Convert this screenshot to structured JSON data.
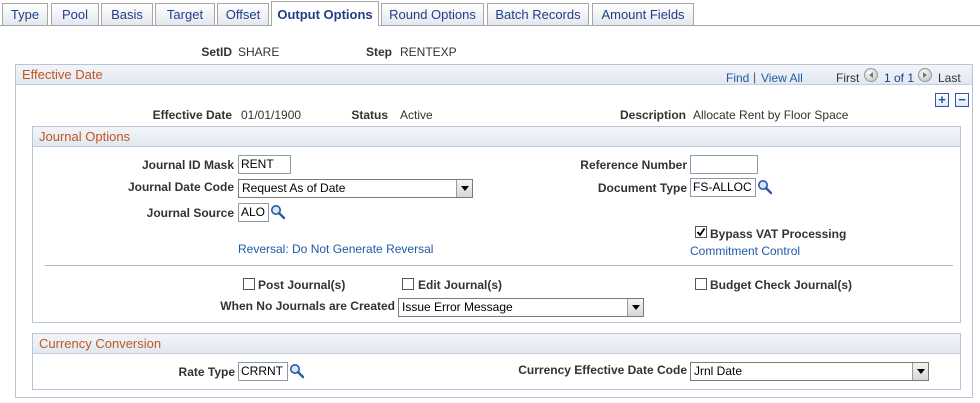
{
  "tabs": [
    {
      "label": "Type",
      "active": false
    },
    {
      "label": "Pool",
      "active": false
    },
    {
      "label": "Basis",
      "active": false
    },
    {
      "label": "Target",
      "active": false
    },
    {
      "label": "Offset",
      "active": false
    },
    {
      "label": "Output Options",
      "active": true
    },
    {
      "label": "Round Options",
      "active": false
    },
    {
      "label": "Batch Records",
      "active": false
    },
    {
      "label": "Amount Fields",
      "active": false
    }
  ],
  "header": {
    "setid_label": "SetID",
    "setid_value": "SHARE",
    "step_label": "Step",
    "step_value": "RENTEXP"
  },
  "effective_date_section": {
    "title": "Effective Date",
    "find": "Find",
    "separator": "|",
    "view_all": "View All",
    "first": "First",
    "page_info": "1 of 1",
    "last": "Last",
    "add_row": "+",
    "delete_row": "−",
    "effective_date_label": "Effective Date",
    "effective_date_value": "01/01/1900",
    "status_label": "Status",
    "status_value": "Active",
    "description_label": "Description",
    "description_value": "Allocate Rent by Floor Space"
  },
  "journal_options": {
    "title": "Journal Options",
    "journal_id_mask_label": "Journal ID Mask",
    "journal_id_mask_value": "RENT",
    "reference_number_label": "Reference Number",
    "reference_number_value": "",
    "journal_date_code_label": "Journal Date Code",
    "journal_date_code_value": "Request As of Date",
    "document_type_label": "Document Type",
    "document_type_value": "FS-ALLOC",
    "journal_source_label": "Journal Source",
    "journal_source_value": "ALO",
    "bypass_vat_label": "Bypass VAT Processing",
    "bypass_vat_checked": true,
    "reversal_link": "Reversal: Do Not Generate Reversal",
    "commitment_control_link": "Commitment Control",
    "post_journals_label": "Post Journal(s)",
    "post_journals_checked": false,
    "edit_journals_label": "Edit Journal(s)",
    "edit_journals_checked": false,
    "budget_check_label": "Budget Check Journal(s)",
    "budget_check_checked": false,
    "no_journals_label": "When No Journals are Created",
    "no_journals_value": "Issue Error Message"
  },
  "currency_conversion": {
    "title": "Currency Conversion",
    "rate_type_label": "Rate Type",
    "rate_type_value": "CRRNT",
    "currency_eff_date_code_label": "Currency Effective Date Code",
    "currency_eff_date_code_value": "Jrnl Date"
  },
  "icons": {
    "lookup": "magnifier-icon",
    "prev": "previous-arrow-icon",
    "next": "next-arrow-icon",
    "check": "checkmark-icon"
  },
  "colors": {
    "tab_text": "#1f3e86",
    "section_title": "#c1561d",
    "link": "#1f5aa6"
  }
}
